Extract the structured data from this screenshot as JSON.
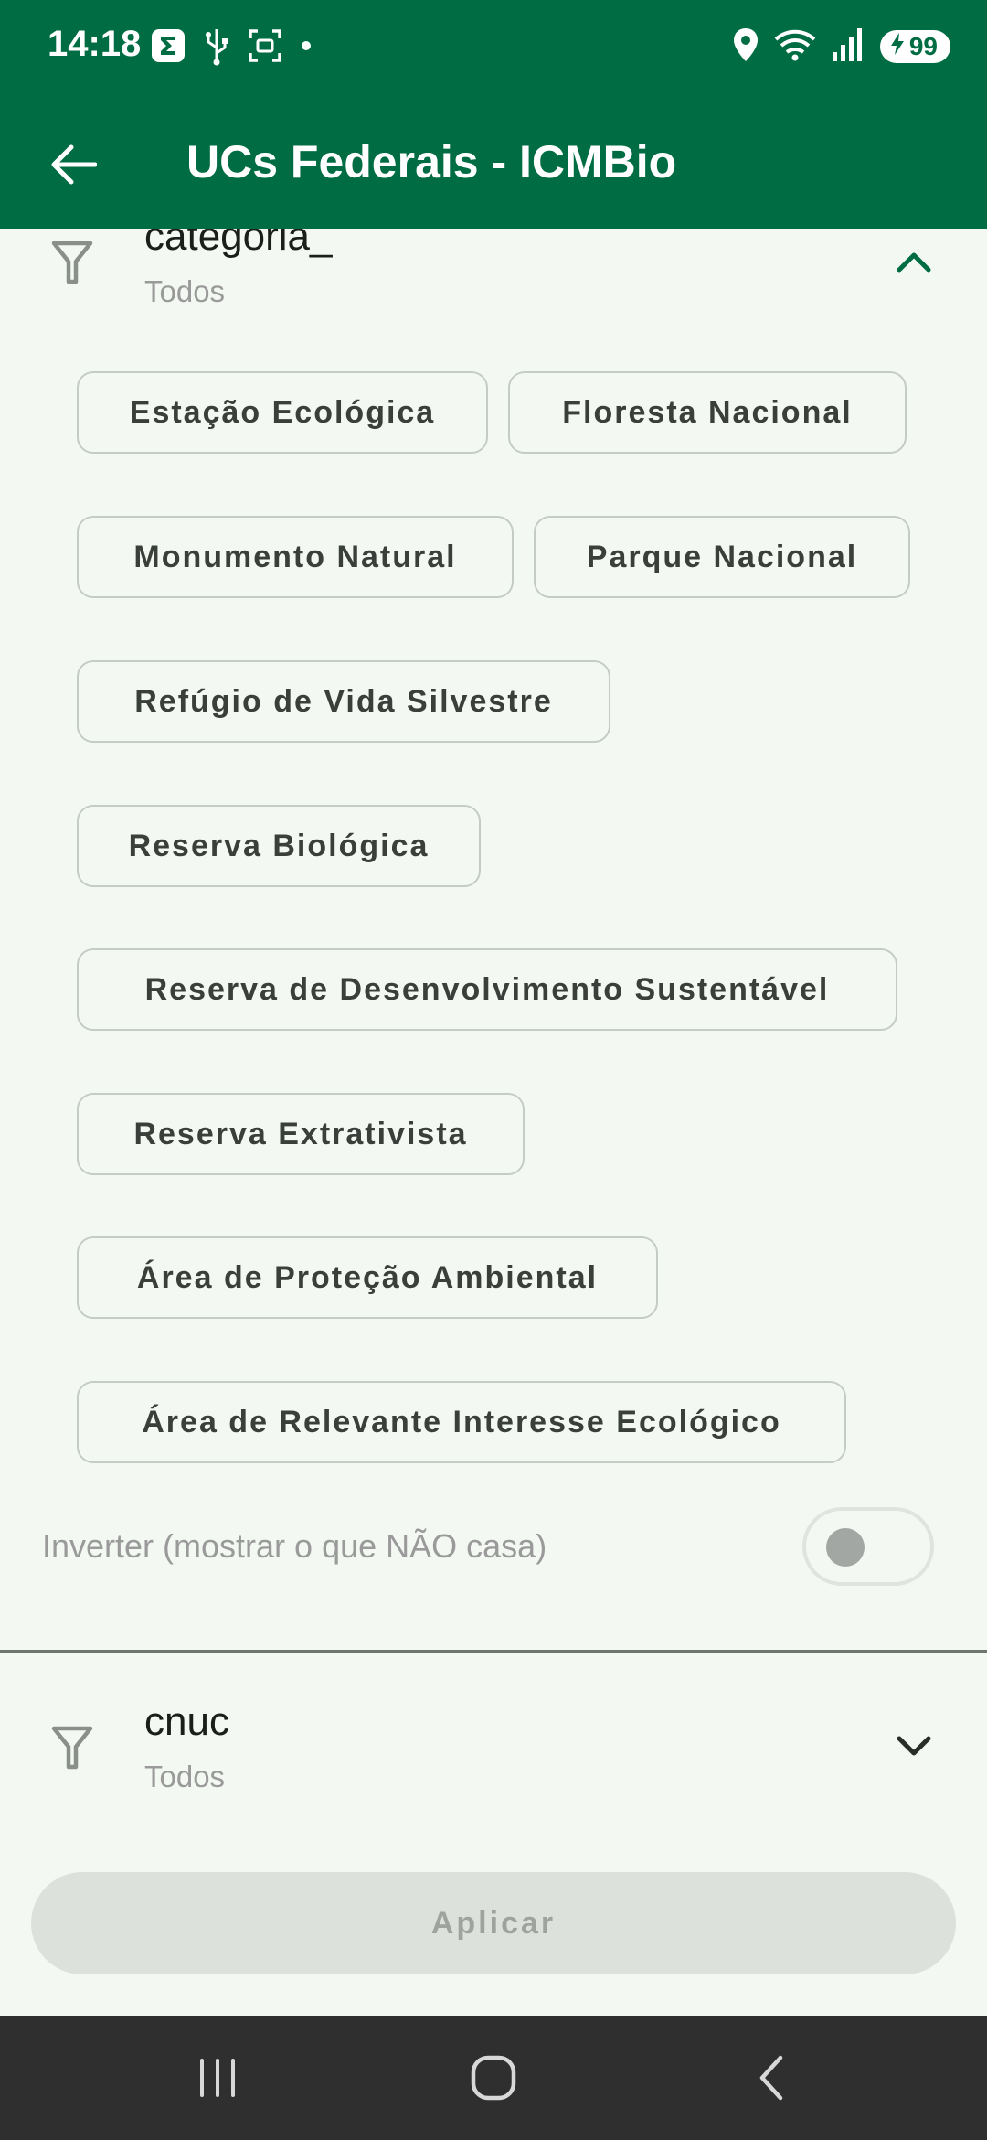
{
  "status_bar": {
    "time": "14:18",
    "battery": "99",
    "icons_left": [
      "sigma-app-icon",
      "usb-icon",
      "screenshot-icon",
      "dot-icon"
    ],
    "icons_right": [
      "location-icon",
      "wifi-icon",
      "signal-icon",
      "battery-charging-icon"
    ]
  },
  "app_bar": {
    "title": "UCs Federais - ICMBio"
  },
  "filters": [
    {
      "title": "categoria_",
      "subtitle": "Todos",
      "expanded": true,
      "options": [
        "Estação Ecológica",
        "Floresta Nacional",
        "Monumento Natural",
        "Parque Nacional",
        "Refúgio de Vida Silvestre",
        "Reserva Biológica",
        "Reserva de Desenvolvimento Sustentável",
        "Reserva Extrativista",
        "Área de Proteção Ambiental",
        "Área de Relevante Interesse Ecológico"
      ],
      "invert_label": "Inverter (mostrar o que NÃO casa)",
      "invert_enabled": false
    },
    {
      "title": "cnuc",
      "subtitle": "Todos",
      "expanded": false
    }
  ],
  "apply_button": {
    "label": "Aplicar"
  },
  "colors": {
    "primary": "#006c43",
    "background": "#f3f8f2",
    "chip_border": "#c5cbc5",
    "disabled_button": "#dce1dc"
  }
}
